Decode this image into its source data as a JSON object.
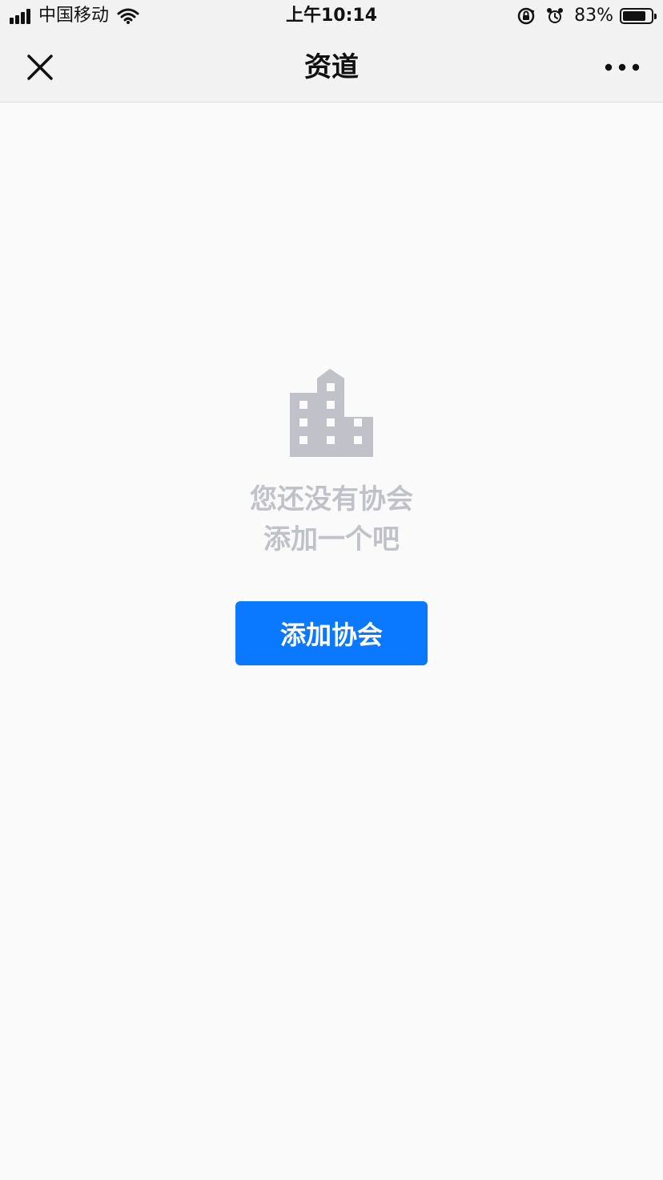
{
  "status_bar": {
    "carrier": "中国移动",
    "time": "上午10:14",
    "battery_percent": "83%",
    "battery_level": 0.83,
    "icons": [
      "signal-icon",
      "wifi-icon",
      "rotation-lock-icon",
      "alarm-icon",
      "battery-icon"
    ]
  },
  "nav": {
    "title": "资道",
    "close_icon": "close-icon",
    "more_icon": "more-icon"
  },
  "empty_state": {
    "icon": "building-icon",
    "line1": "您还没有协会",
    "line2": "添加一个吧",
    "color": "#c0c1c9"
  },
  "actions": {
    "add_label": "添加协会",
    "accent": "#0a78ff"
  }
}
